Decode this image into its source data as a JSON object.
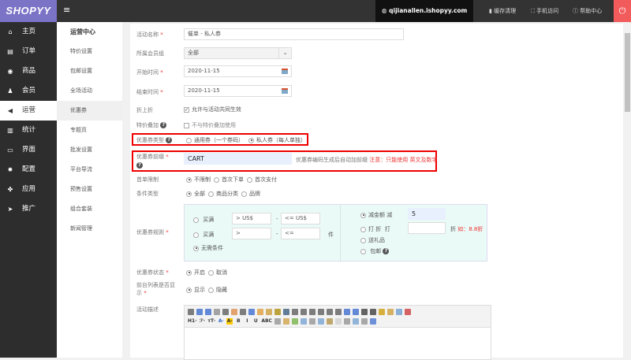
{
  "header": {
    "logo": "SHOPYY",
    "domain": "qijianallen.ishopyy.com",
    "cache": "缓存清理",
    "mobile": "手机访问",
    "help": "帮助中心"
  },
  "sidebar": {
    "items": [
      {
        "label": "主页",
        "icon": "home-icon",
        "glyph": "⌂"
      },
      {
        "label": "订单",
        "icon": "order-icon",
        "glyph": "▤"
      },
      {
        "label": "商品",
        "icon": "cube-icon",
        "glyph": "◉"
      },
      {
        "label": "会员",
        "icon": "users-icon",
        "glyph": "♟"
      },
      {
        "label": "运营",
        "icon": "megaphone-icon",
        "glyph": "◀"
      },
      {
        "label": "统计",
        "icon": "bar-chart-icon",
        "glyph": "▥"
      },
      {
        "label": "界面",
        "icon": "layout-icon",
        "glyph": "▭"
      },
      {
        "label": "配置",
        "icon": "gear-icon",
        "glyph": "✹"
      },
      {
        "label": "应用",
        "icon": "puzzle-icon",
        "glyph": "✤"
      },
      {
        "label": "推广",
        "icon": "send-icon",
        "glyph": "➤"
      }
    ],
    "active": 4
  },
  "submenu": {
    "title": "运营中心",
    "items": [
      "特价设置",
      "包邮设置",
      "全场活动",
      "优惠券",
      "专题页",
      "批发设置",
      "平台导流",
      "预售设置",
      "组合套装",
      "新闻管理"
    ],
    "active": 3
  },
  "form": {
    "name": {
      "label": "活动名称",
      "value": "催单 - 私人券"
    },
    "group": {
      "label": "所属会员组",
      "value": "全部"
    },
    "start": {
      "label": "开始时间",
      "value": "2020-11-15"
    },
    "end": {
      "label": "结束时间",
      "value": "2020-11-15"
    },
    "stack": {
      "label": "折上折",
      "option": "允许与活动共同生效",
      "checked": true
    },
    "special": {
      "label": "特价叠加",
      "option": "不与特价叠加使用",
      "checked": false
    },
    "type": {
      "label": "优惠券类型",
      "options": [
        "通用券（一个券码）",
        "私人券（每人单独）"
      ],
      "selected": 1
    },
    "prefix": {
      "label": "优惠券前缀",
      "value": "CART",
      "hint": "优惠券编码生成后自动加前缀",
      "warn": "注意：只能使用 英文及数字"
    },
    "first": {
      "label": "首单限制",
      "options": [
        "不限制",
        "首次下单",
        "首次支付"
      ],
      "selected": 0
    },
    "cond": {
      "label": "条件类型",
      "options": [
        "全部",
        "商品分类",
        "品牌"
      ],
      "selected": 0
    },
    "rules": {
      "label": "优惠券规则",
      "buy1": "买满",
      "p1a": "> US$",
      "p1b": "<= US$",
      "buy2": "买满",
      "p2a": ">",
      "p2b": "<=",
      "unit": "件",
      "dash": "-",
      "none": "无需条件",
      "left_selected": 2,
      "reduce": "减金额",
      "reduce_verb": "减",
      "reduce_value": "5",
      "discount": "打 折",
      "discount_verb": "打",
      "discount_unit": "折",
      "discount_eg": "如：8.8折",
      "gift": "送礼品",
      "shipping": "包邮",
      "right_selected": 0
    },
    "status": {
      "label": "优惠券状态",
      "options": [
        "开启",
        "取消"
      ],
      "selected": 0
    },
    "display": {
      "label": "前台列表是否显示",
      "options": [
        "显示",
        "隐藏"
      ],
      "selected": 0
    },
    "desc": {
      "label": "活动描述",
      "toolbar_row2_text": [
        "H1·",
        "ℱ·",
        "тT·",
        "A·",
        "A·",
        "B",
        "I",
        "U",
        "ABC"
      ]
    }
  }
}
